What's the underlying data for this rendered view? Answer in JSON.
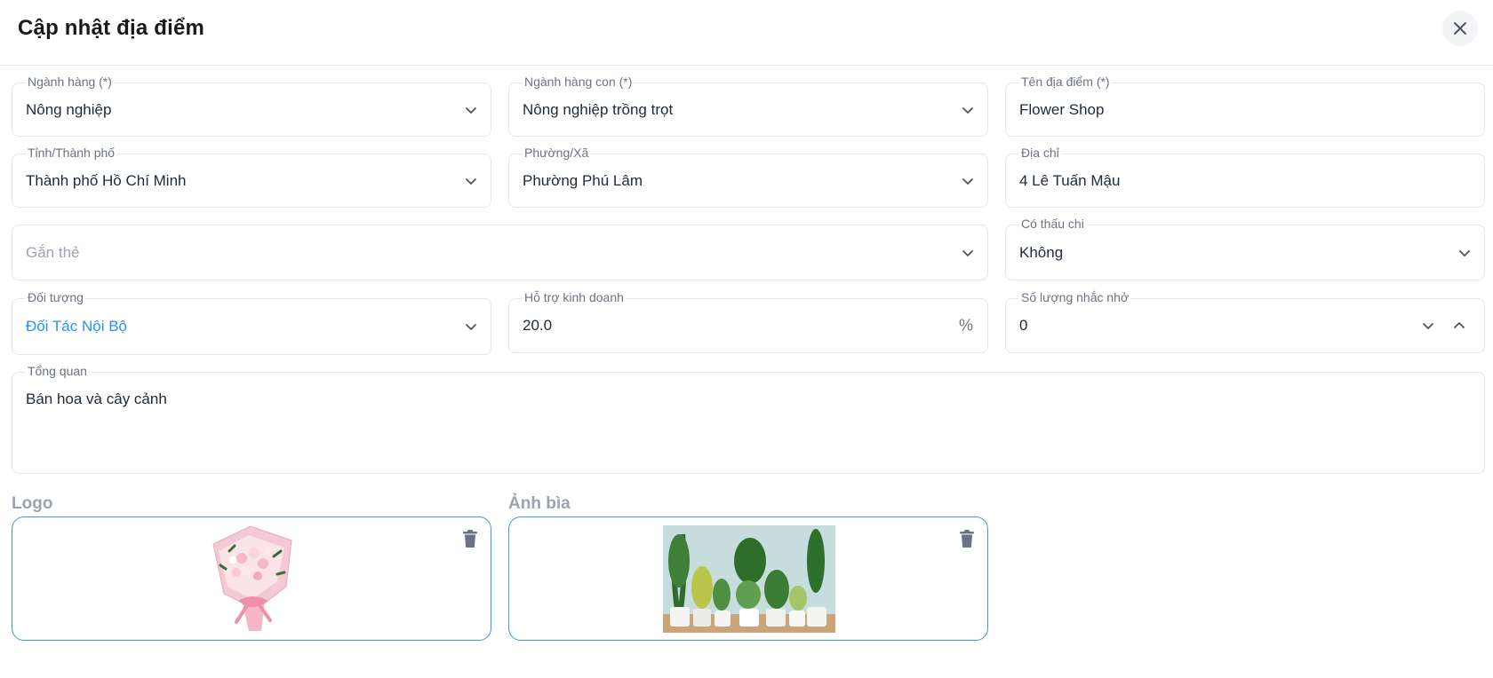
{
  "header": {
    "title": "Cập nhật địa điểm",
    "close_icon": "close-icon"
  },
  "fields": {
    "industry": {
      "label": "Ngành hàng (*)",
      "value": "Nông nghiệp"
    },
    "sub_industry": {
      "label": "Ngành hàng con (*)",
      "value": "Nông nghiệp trồng trọt"
    },
    "location_name": {
      "label": "Tên địa điểm (*)",
      "value": "Flower Shop"
    },
    "province": {
      "label": "Tỉnh/Thành phố",
      "value": "Thành phố Hồ Chí Minh"
    },
    "ward": {
      "label": "Phường/Xã",
      "value": "Phường Phú Lâm"
    },
    "address": {
      "label": "Địa chỉ",
      "value": "4 Lê Tuấn Mậu"
    },
    "tags": {
      "placeholder": "Gắn thẻ"
    },
    "overdraft": {
      "label": "Có thấu chi",
      "value": "Không"
    },
    "audience": {
      "label": "Đối tượng",
      "value": "Đối Tác Nội Bộ"
    },
    "business_support": {
      "label": "Hỗ trợ kinh doanh",
      "value": "20.0",
      "suffix": "%"
    },
    "reminder_count": {
      "label": "Số lượng nhắc nhở",
      "value": "0"
    },
    "overview": {
      "label": "Tổng quan",
      "value": "Bán hoa và cây cảnh"
    }
  },
  "uploads": {
    "logo": {
      "label": "Logo",
      "image_icon": "flower-bouquet-image"
    },
    "cover": {
      "label": "Ảnh bìa",
      "image_icon": "potted-plants-image"
    }
  },
  "colors": {
    "accent": "#2196f3",
    "upload_border": "#3b9ae1",
    "field_border": "#e5e7eb",
    "label": "#6b7280"
  }
}
